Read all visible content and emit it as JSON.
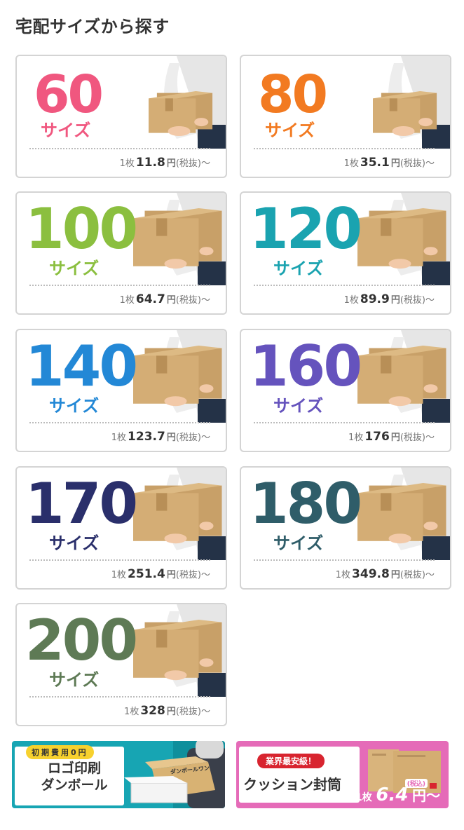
{
  "heading": "宅配サイズから探す",
  "cards": [
    {
      "size": "60",
      "label": "サイズ",
      "qty": "1枚",
      "price": "11.8",
      "yen": "円",
      "tax": "(税抜)～",
      "color": "#f0577f"
    },
    {
      "size": "80",
      "label": "サイズ",
      "qty": "1枚",
      "price": "35.1",
      "yen": "円",
      "tax": "(税抜)～",
      "color": "#f27a21"
    },
    {
      "size": "100",
      "label": "サイズ",
      "qty": "1枚",
      "price": "64.7",
      "yen": "円",
      "tax": "(税抜)～",
      "color": "#8bbf3f"
    },
    {
      "size": "120",
      "label": "サイズ",
      "qty": "1枚",
      "price": "89.9",
      "yen": "円",
      "tax": "(税抜)～",
      "color": "#1aa3b0"
    },
    {
      "size": "140",
      "label": "サイズ",
      "qty": "1枚",
      "price": "123.7",
      "yen": "円",
      "tax": "(税抜)～",
      "color": "#2388d6"
    },
    {
      "size": "160",
      "label": "サイズ",
      "qty": "1枚",
      "price": "176",
      "yen": "円",
      "tax": "(税抜)～",
      "color": "#6553bd"
    },
    {
      "size": "170",
      "label": "サイズ",
      "qty": "1枚",
      "price": "251.4",
      "yen": "円",
      "tax": "(税抜)～",
      "color": "#2a2f6b"
    },
    {
      "size": "180",
      "label": "サイズ",
      "qty": "1枚",
      "price": "349.8",
      "yen": "円",
      "tax": "(税抜)～",
      "color": "#2f5d69"
    },
    {
      "size": "200",
      "label": "サイズ",
      "qty": "1枚",
      "price": "328",
      "yen": "円",
      "tax": "(税抜)～",
      "color": "#5e7a55"
    }
  ],
  "banners": {
    "logo": {
      "badge": "初期費用0円",
      "title_line1": "ロゴ印刷",
      "title_line2": "ダンボール",
      "box_print": "ダンボールワン"
    },
    "cushion": {
      "badge": "業界最安級！",
      "title": "クッション封筒",
      "qty": "1枚",
      "price": "6.4",
      "yen": "円～",
      "tax": "(税込)"
    }
  }
}
